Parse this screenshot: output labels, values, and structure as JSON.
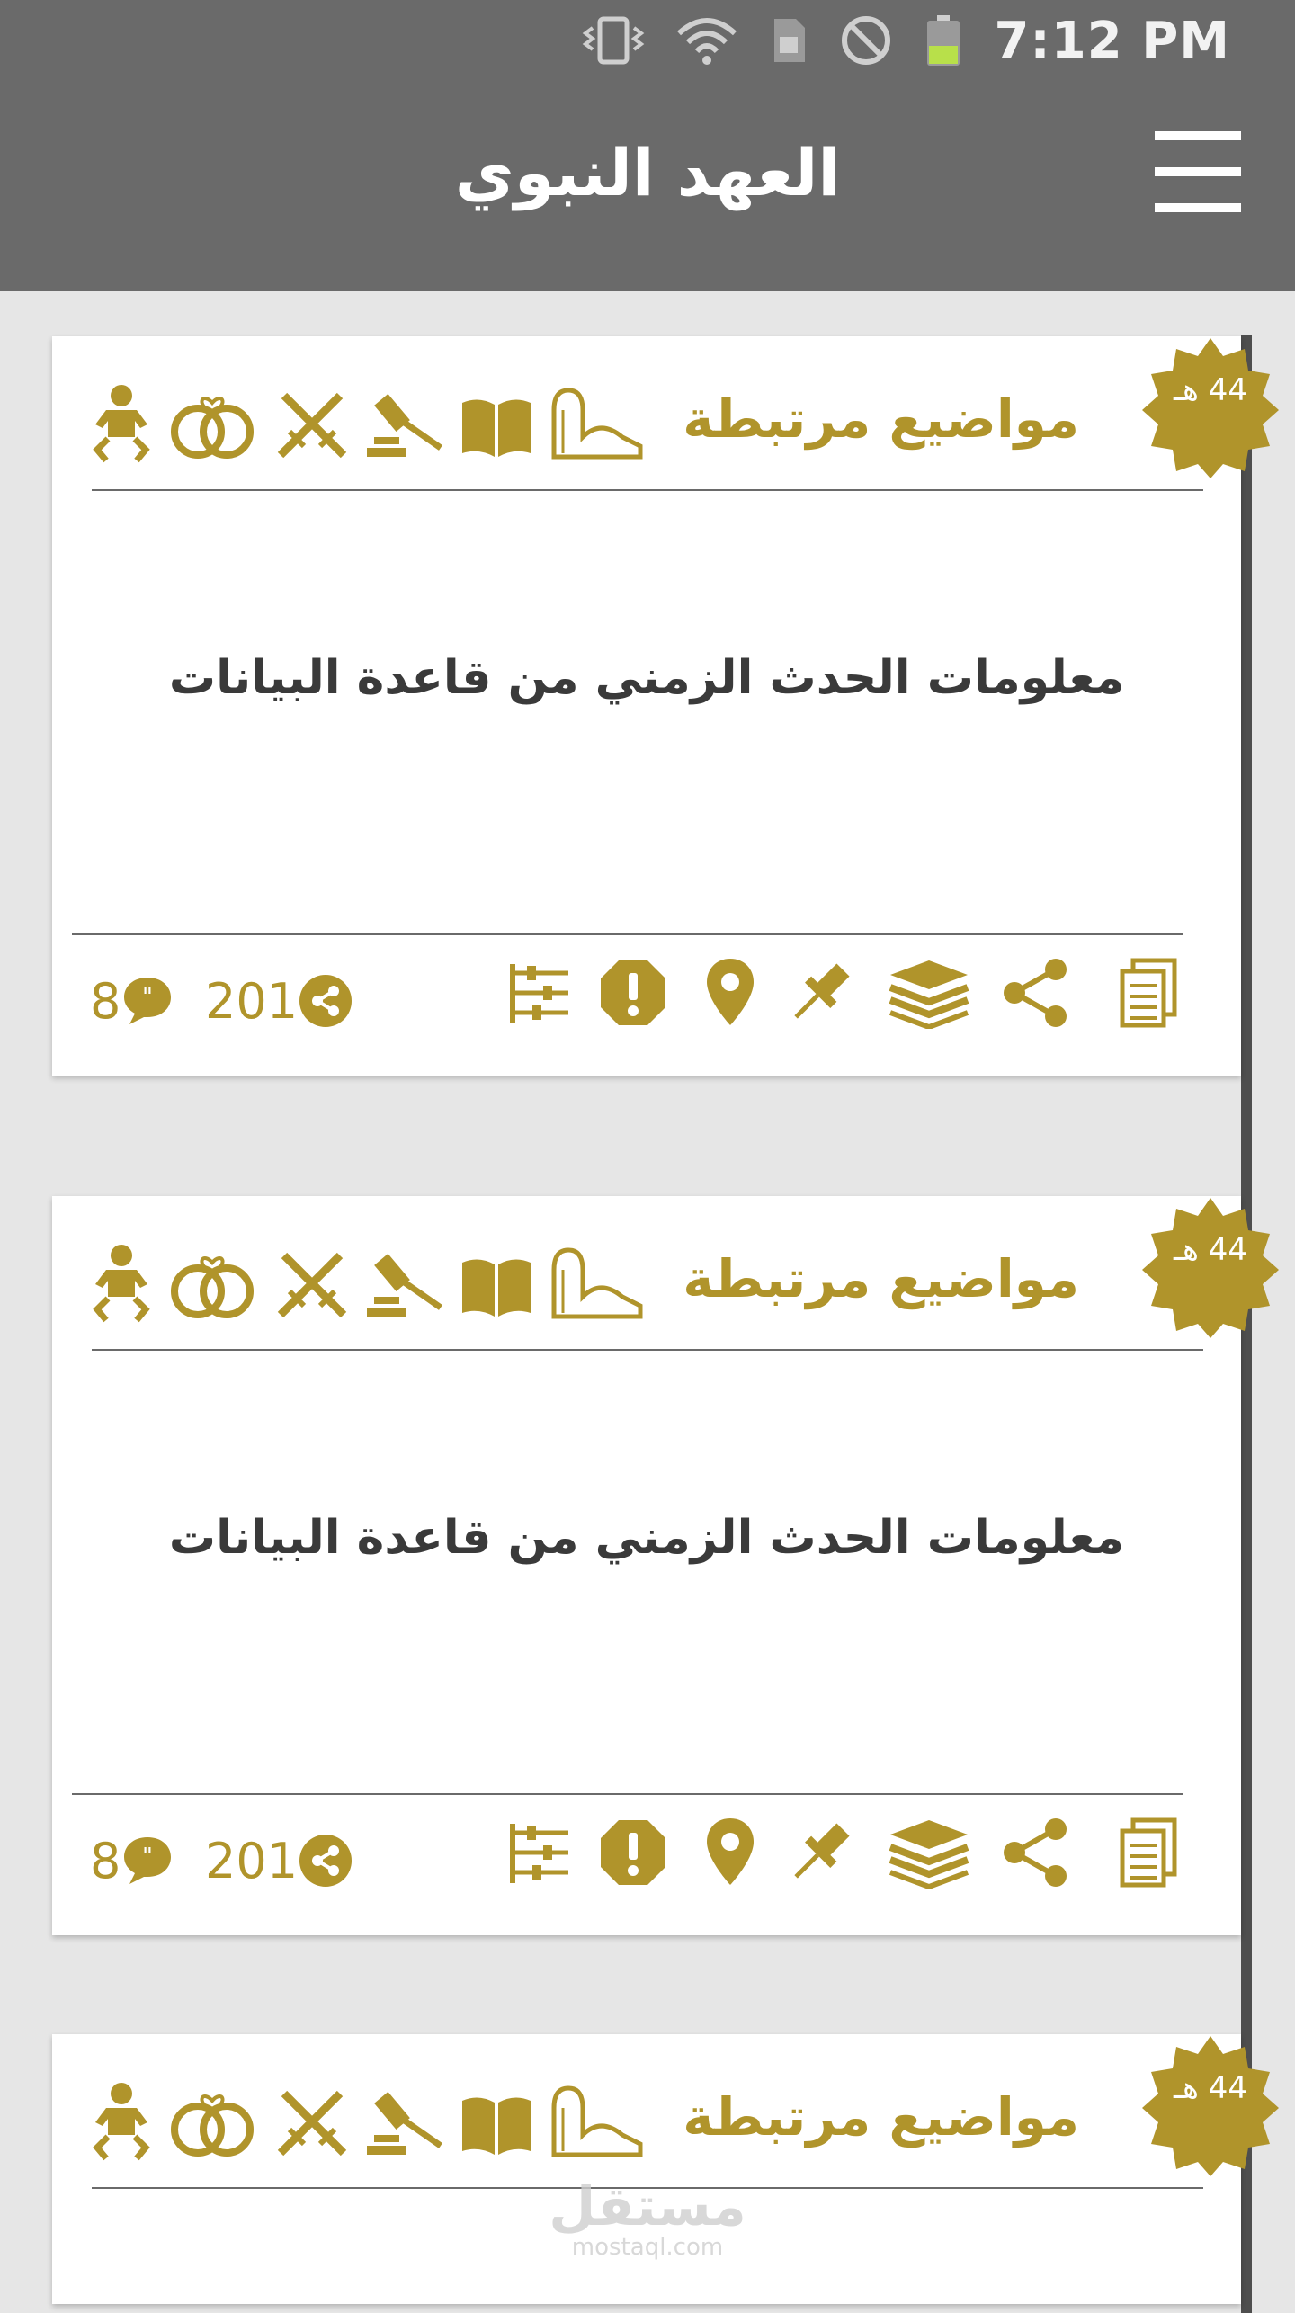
{
  "status_bar": {
    "time": "7:12 PM"
  },
  "header": {
    "title": "العهد النبوي"
  },
  "cards": [
    {
      "badge": "44 هـ",
      "topics_label": "مواضيع مرتبطة",
      "body": "معلومات الحدث الزمني من قاعدة البيانات",
      "shares": "201",
      "comments": "8"
    },
    {
      "badge": "44 هـ",
      "topics_label": "مواضيع مرتبطة",
      "body": "معلومات الحدث الزمني من قاعدة البيانات",
      "shares": "201",
      "comments": "8"
    },
    {
      "badge": "44 هـ",
      "topics_label": "مواضيع مرتبطة"
    }
  ],
  "topic_icons": [
    "baby-icon",
    "rings-icon",
    "crossed-swords-icon",
    "gavel-icon",
    "book-icon",
    "mosque-icon"
  ],
  "action_icons": [
    "document-icon",
    "share-icon",
    "layers-icon",
    "pin-icon",
    "location-icon",
    "alert-icon",
    "timeline-icon"
  ],
  "watermark": {
    "arabic": "مستقل",
    "latin": "mostaql.com"
  },
  "colors": {
    "accent": "#b0942b",
    "appbar": "#6a6a6a",
    "background": "#e6e6e6"
  }
}
